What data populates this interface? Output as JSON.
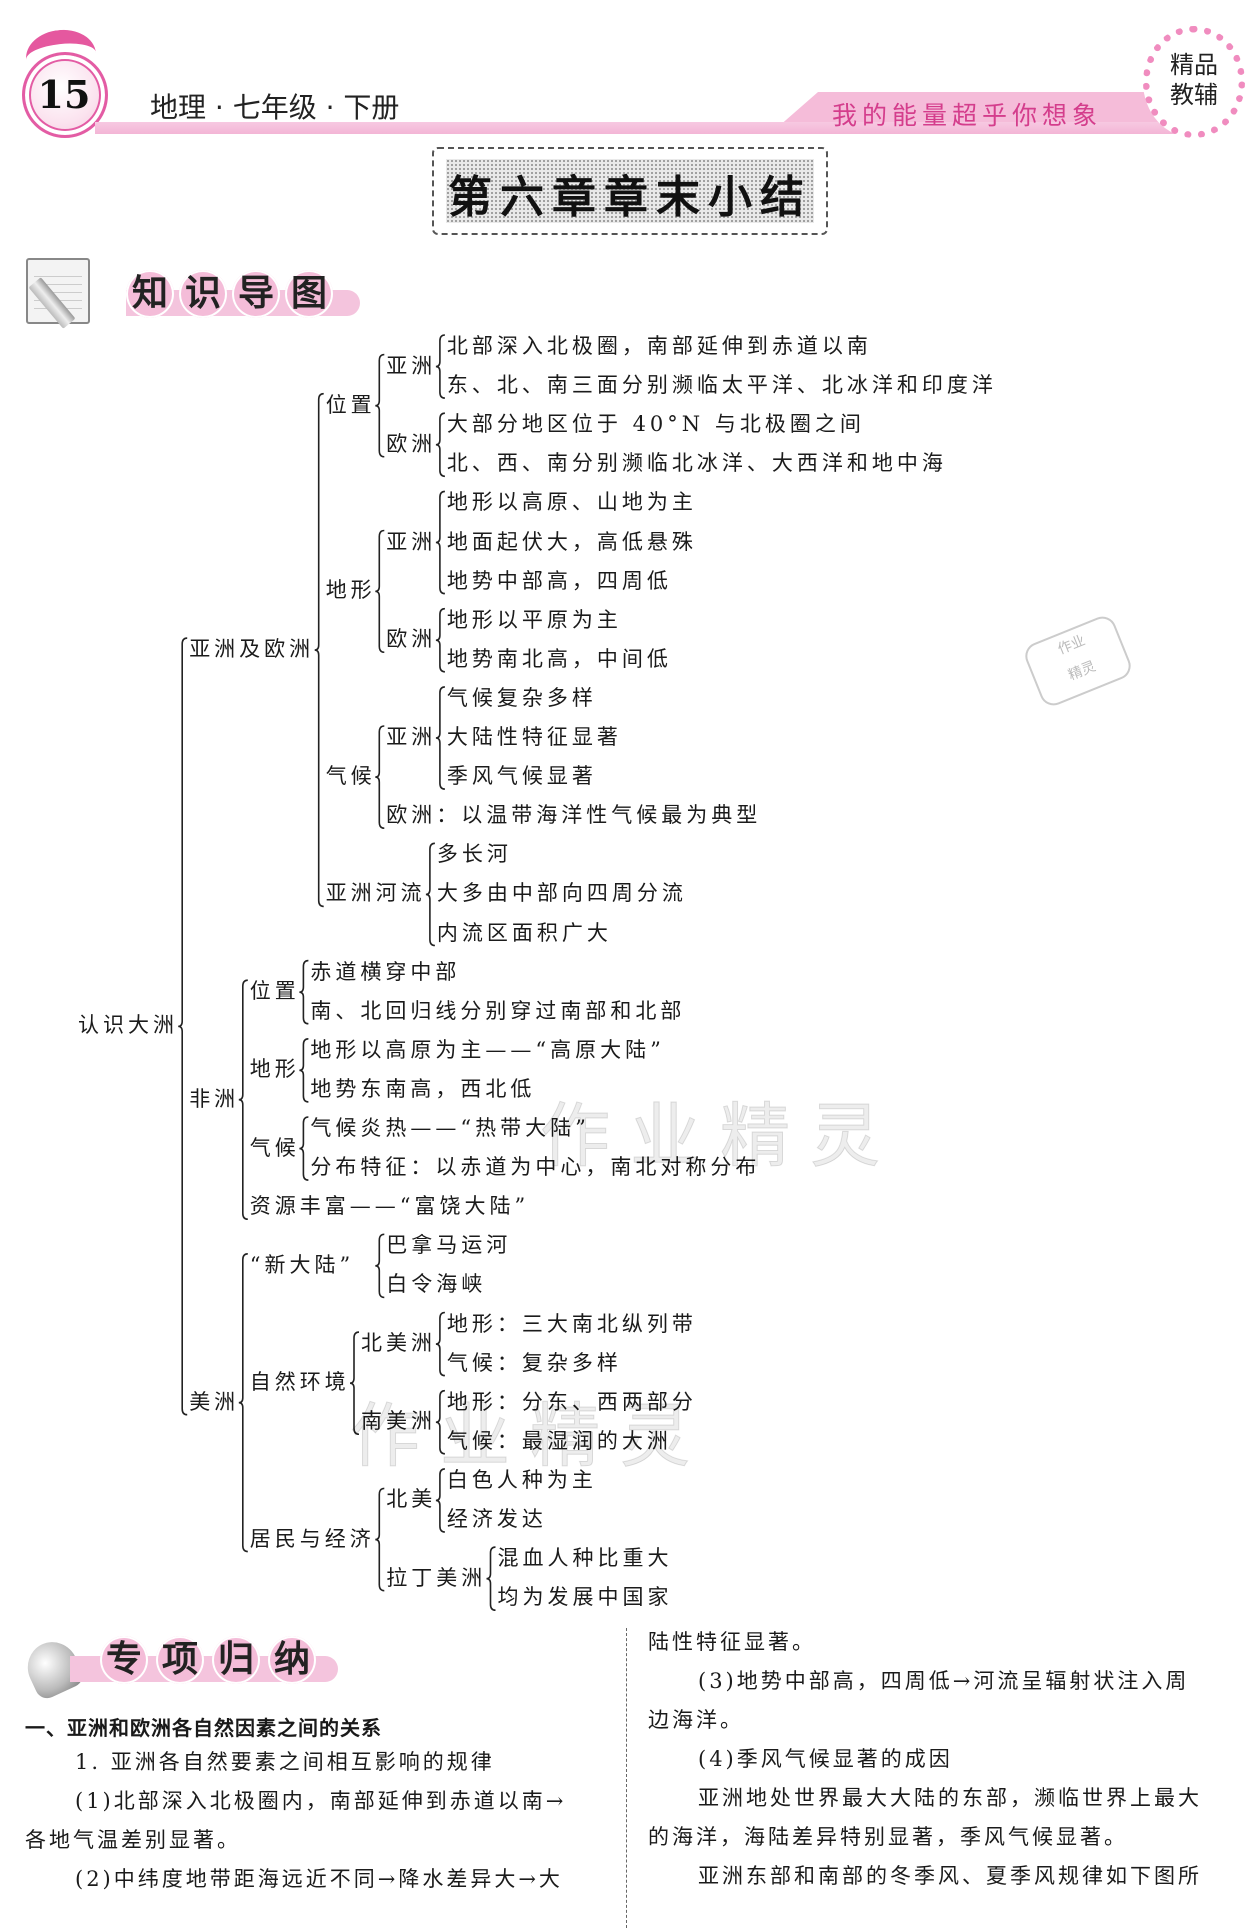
{
  "header": {
    "page_number": "15",
    "subject": "地理 · 七年级 · 下册",
    "motto": "我的能量超乎你想象",
    "badge": [
      "精品",
      "教辅"
    ],
    "accent_color": "#e35ca4"
  },
  "chapter_title": "第六章章末小结",
  "sections": {
    "mind_map_heading": [
      "知",
      "识",
      "导",
      "图"
    ],
    "summary_heading": [
      "专",
      "项",
      "归",
      "纳"
    ]
  },
  "mind_map": {
    "label": "认识大洲",
    "children": [
      {
        "label": "亚洲及欧洲",
        "children": [
          {
            "label": "位置",
            "children": [
              {
                "label": "亚洲",
                "children": [
                  {
                    "label": "北部深入北极圈，南部延伸到赤道以南"
                  },
                  {
                    "label": "东、北、南三面分别濒临太平洋、北冰洋和印度洋"
                  }
                ]
              },
              {
                "label": "欧洲",
                "children": [
                  {
                    "label": "大部分地区位于 40°N 与北极圈之间"
                  },
                  {
                    "label": "北、西、南分别濒临北冰洋、大西洋和地中海"
                  }
                ]
              }
            ]
          },
          {
            "label": "地形",
            "children": [
              {
                "label": "亚洲",
                "children": [
                  {
                    "label": "地形以高原、山地为主"
                  },
                  {
                    "label": "地面起伏大，高低悬殊"
                  },
                  {
                    "label": "地势中部高，四周低"
                  }
                ]
              },
              {
                "label": "欧洲",
                "children": [
                  {
                    "label": "地形以平原为主"
                  },
                  {
                    "label": "地势南北高，中间低"
                  }
                ]
              }
            ]
          },
          {
            "label": "气候",
            "children": [
              {
                "label": "亚洲",
                "children": [
                  {
                    "label": "气候复杂多样"
                  },
                  {
                    "label": "大陆性特征显著"
                  },
                  {
                    "label": "季风气候显著"
                  }
                ]
              },
              {
                "label": "欧洲：以温带海洋性气候最为典型"
              }
            ]
          },
          {
            "label": "亚洲河流",
            "children": [
              {
                "label": "多长河"
              },
              {
                "label": "大多由中部向四周分流"
              },
              {
                "label": "内流区面积广大"
              }
            ]
          }
        ]
      },
      {
        "label": "非洲",
        "children": [
          {
            "label": "位置",
            "children": [
              {
                "label": "赤道横穿中部"
              },
              {
                "label": "南、北回归线分别穿过南部和北部"
              }
            ]
          },
          {
            "label": "地形",
            "children": [
              {
                "label": "地形以高原为主——“高原大陆”"
              },
              {
                "label": "地势东南高，西北低"
              }
            ]
          },
          {
            "label": "气候",
            "children": [
              {
                "label": "气候炎热——“热带大陆”"
              },
              {
                "label": "分布特征：以赤道为中心，南北对称分布"
              }
            ]
          },
          {
            "label": "资源丰富——“富饶大陆”"
          }
        ]
      },
      {
        "label": "美洲",
        "children": [
          {
            "label": "“新大陆”",
            "children": [
              {
                "label": "巴拿马运河"
              },
              {
                "label": "白令海峡"
              }
            ]
          },
          {
            "label": "自然环境",
            "children": [
              {
                "label": "北美洲",
                "children": [
                  {
                    "label": "地形：三大南北纵列带"
                  },
                  {
                    "label": "气候：复杂多样"
                  }
                ]
              },
              {
                "label": "南美洲",
                "children": [
                  {
                    "label": "地形：分东、西两部分"
                  },
                  {
                    "label": "气候：最湿润的大洲"
                  }
                ]
              }
            ]
          },
          {
            "label": "居民与经济",
            "children": [
              {
                "label": "北美",
                "children": [
                  {
                    "label": "白色人种为主"
                  },
                  {
                    "label": "经济发达"
                  }
                ]
              },
              {
                "label": "拉丁美洲",
                "children": [
                  {
                    "label": "混血人种比重大"
                  },
                  {
                    "label": "均为发展中国家"
                  }
                ]
              }
            ]
          }
        ]
      }
    ]
  },
  "summary": {
    "heading": "一、亚洲和欧洲各自然因素之间的关系",
    "left_lines": [
      "1. 亚洲各自然要素之间相互影响的规律",
      "(1)北部深入北极圈内，南部延伸到赤道以南→",
      "各地气温差别显著。",
      "(2)中纬度地带距海远近不同→降水差异大→大"
    ],
    "right_lines": [
      "陆性特征显著。",
      "(3)地势中部高，四周低→河流呈辐射状注入周",
      "边海洋。",
      "(4)季风气候显著的成因",
      "亚洲地处世界最大大陆的东部，濒临世界上最大",
      "的海洋，海陆差异特别显著，季风气候显著。",
      "亚洲东部和南部的冬季风、夏季风规律如下图所"
    ]
  },
  "watermark": "作业精灵",
  "stamp": [
    "作业",
    "精灵"
  ]
}
